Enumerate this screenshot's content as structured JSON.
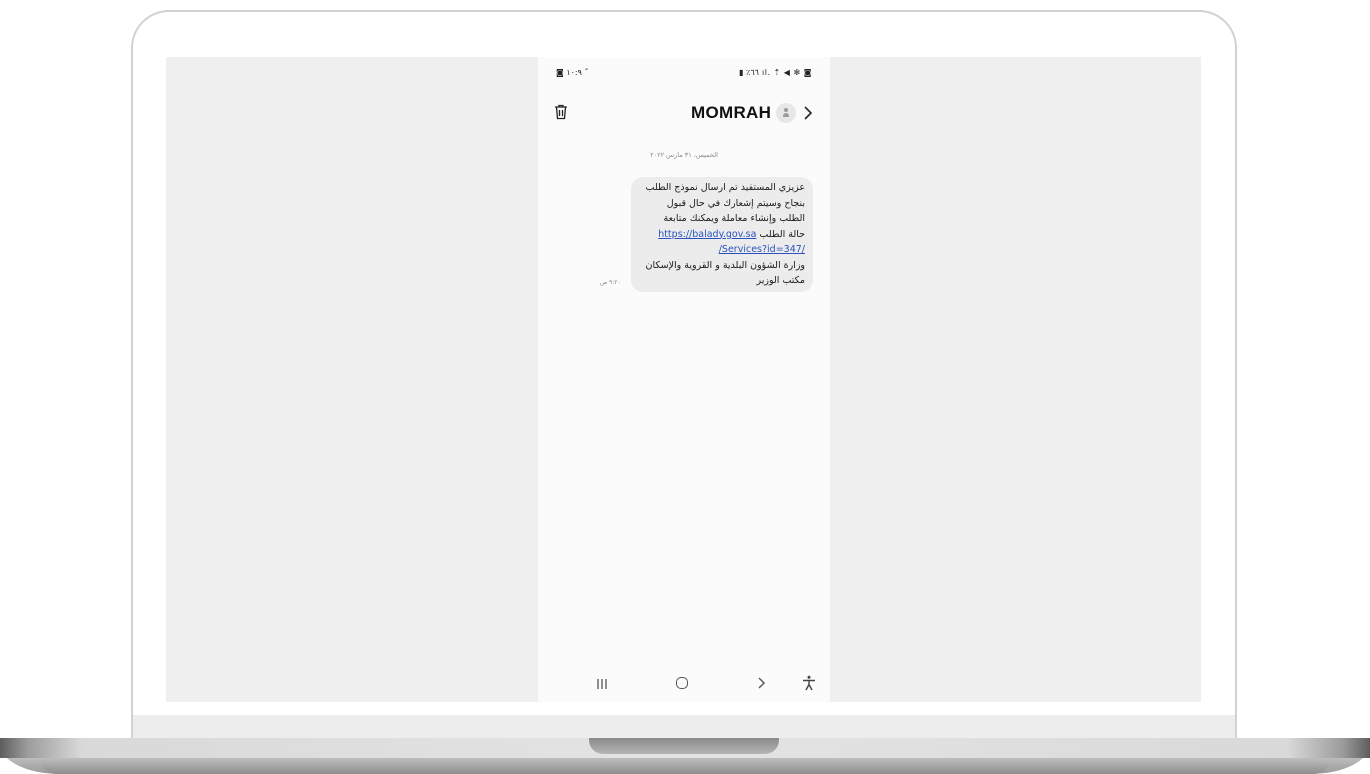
{
  "statusbar": {
    "left": "ً ١٠:٩ ◙",
    "right": "◙ ✻ ◀ ⇡ .ıl ٦٦٪ ▮"
  },
  "conversation": {
    "contact_name": "MOMRAH",
    "date_separator": "الخميس، ٣١ مارس ٢٠٢٢",
    "message": {
      "lines": [
        "عزيزي المستفيد تم ارسال نموذج الطلب",
        "بنجاح وسيتم إشعارك في حال قبول",
        "الطلب وإنشاء معاملة ويمكنك متابعة",
        "حالة الطلب"
      ],
      "link_part1": "https://balady.gov.sa",
      "link_part2": "/Services?id=347/",
      "closing_lines": [
        "وزارة الشؤون البلدية و القروية والإسكان",
        "مكتب الوزير"
      ],
      "time": "٩:٢٠ ص"
    }
  },
  "icons": {
    "trash": "trash-icon",
    "avatar": "person-icon",
    "chevron": "chevron-right-icon",
    "nav": [
      "recents-icon",
      "home-icon",
      "back-icon",
      "accessibility-icon"
    ]
  },
  "colors": {
    "link": "#2a52be",
    "bubble": "#ececec",
    "screen_bg": "#efefef"
  }
}
